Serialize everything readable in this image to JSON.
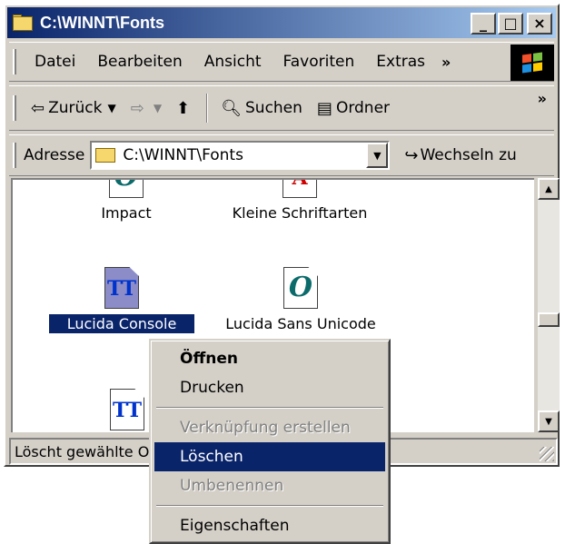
{
  "window": {
    "title": "C:\\WINNT\\Fonts",
    "buttons": {
      "minimize": "_",
      "maximize": "□",
      "close": "×"
    }
  },
  "menubar": {
    "items": [
      "Datei",
      "Bearbeiten",
      "Ansicht",
      "Favoriten",
      "Extras"
    ],
    "overflow": "»"
  },
  "toolbar": {
    "back": "Zurück",
    "search": "Suchen",
    "folders": "Ordner",
    "overflow": "»"
  },
  "address": {
    "label": "Adresse",
    "value": "C:\\WINNT\\Fonts",
    "go": "Wechseln zu"
  },
  "files": [
    {
      "name": "Impact",
      "glyph": "O"
    },
    {
      "name": "Kleine Schriftarten",
      "glyph": "A"
    },
    {
      "name": "Lucida Console",
      "glyph": "TT",
      "selected": true
    },
    {
      "name": "Lucida Sans Unicode",
      "glyph": "O"
    },
    {
      "name": "",
      "glyph": "TT"
    }
  ],
  "status": {
    "text": "Löscht gewählte O"
  },
  "context_menu": {
    "items": [
      {
        "label": "Öffnen",
        "state": "default"
      },
      {
        "label": "Drucken",
        "state": "normal"
      },
      {
        "label": "Verknüpfung erstellen",
        "state": "disabled"
      },
      {
        "label": "Löschen",
        "state": "highlighted"
      },
      {
        "label": "Umbenennen",
        "state": "disabled"
      },
      {
        "label": "Eigenschaften",
        "state": "normal"
      }
    ]
  },
  "colors": {
    "titlebar_start": "#0a246a",
    "titlebar_end": "#a6caf0",
    "selection": "#0a246a",
    "face": "#d4d0c8"
  }
}
